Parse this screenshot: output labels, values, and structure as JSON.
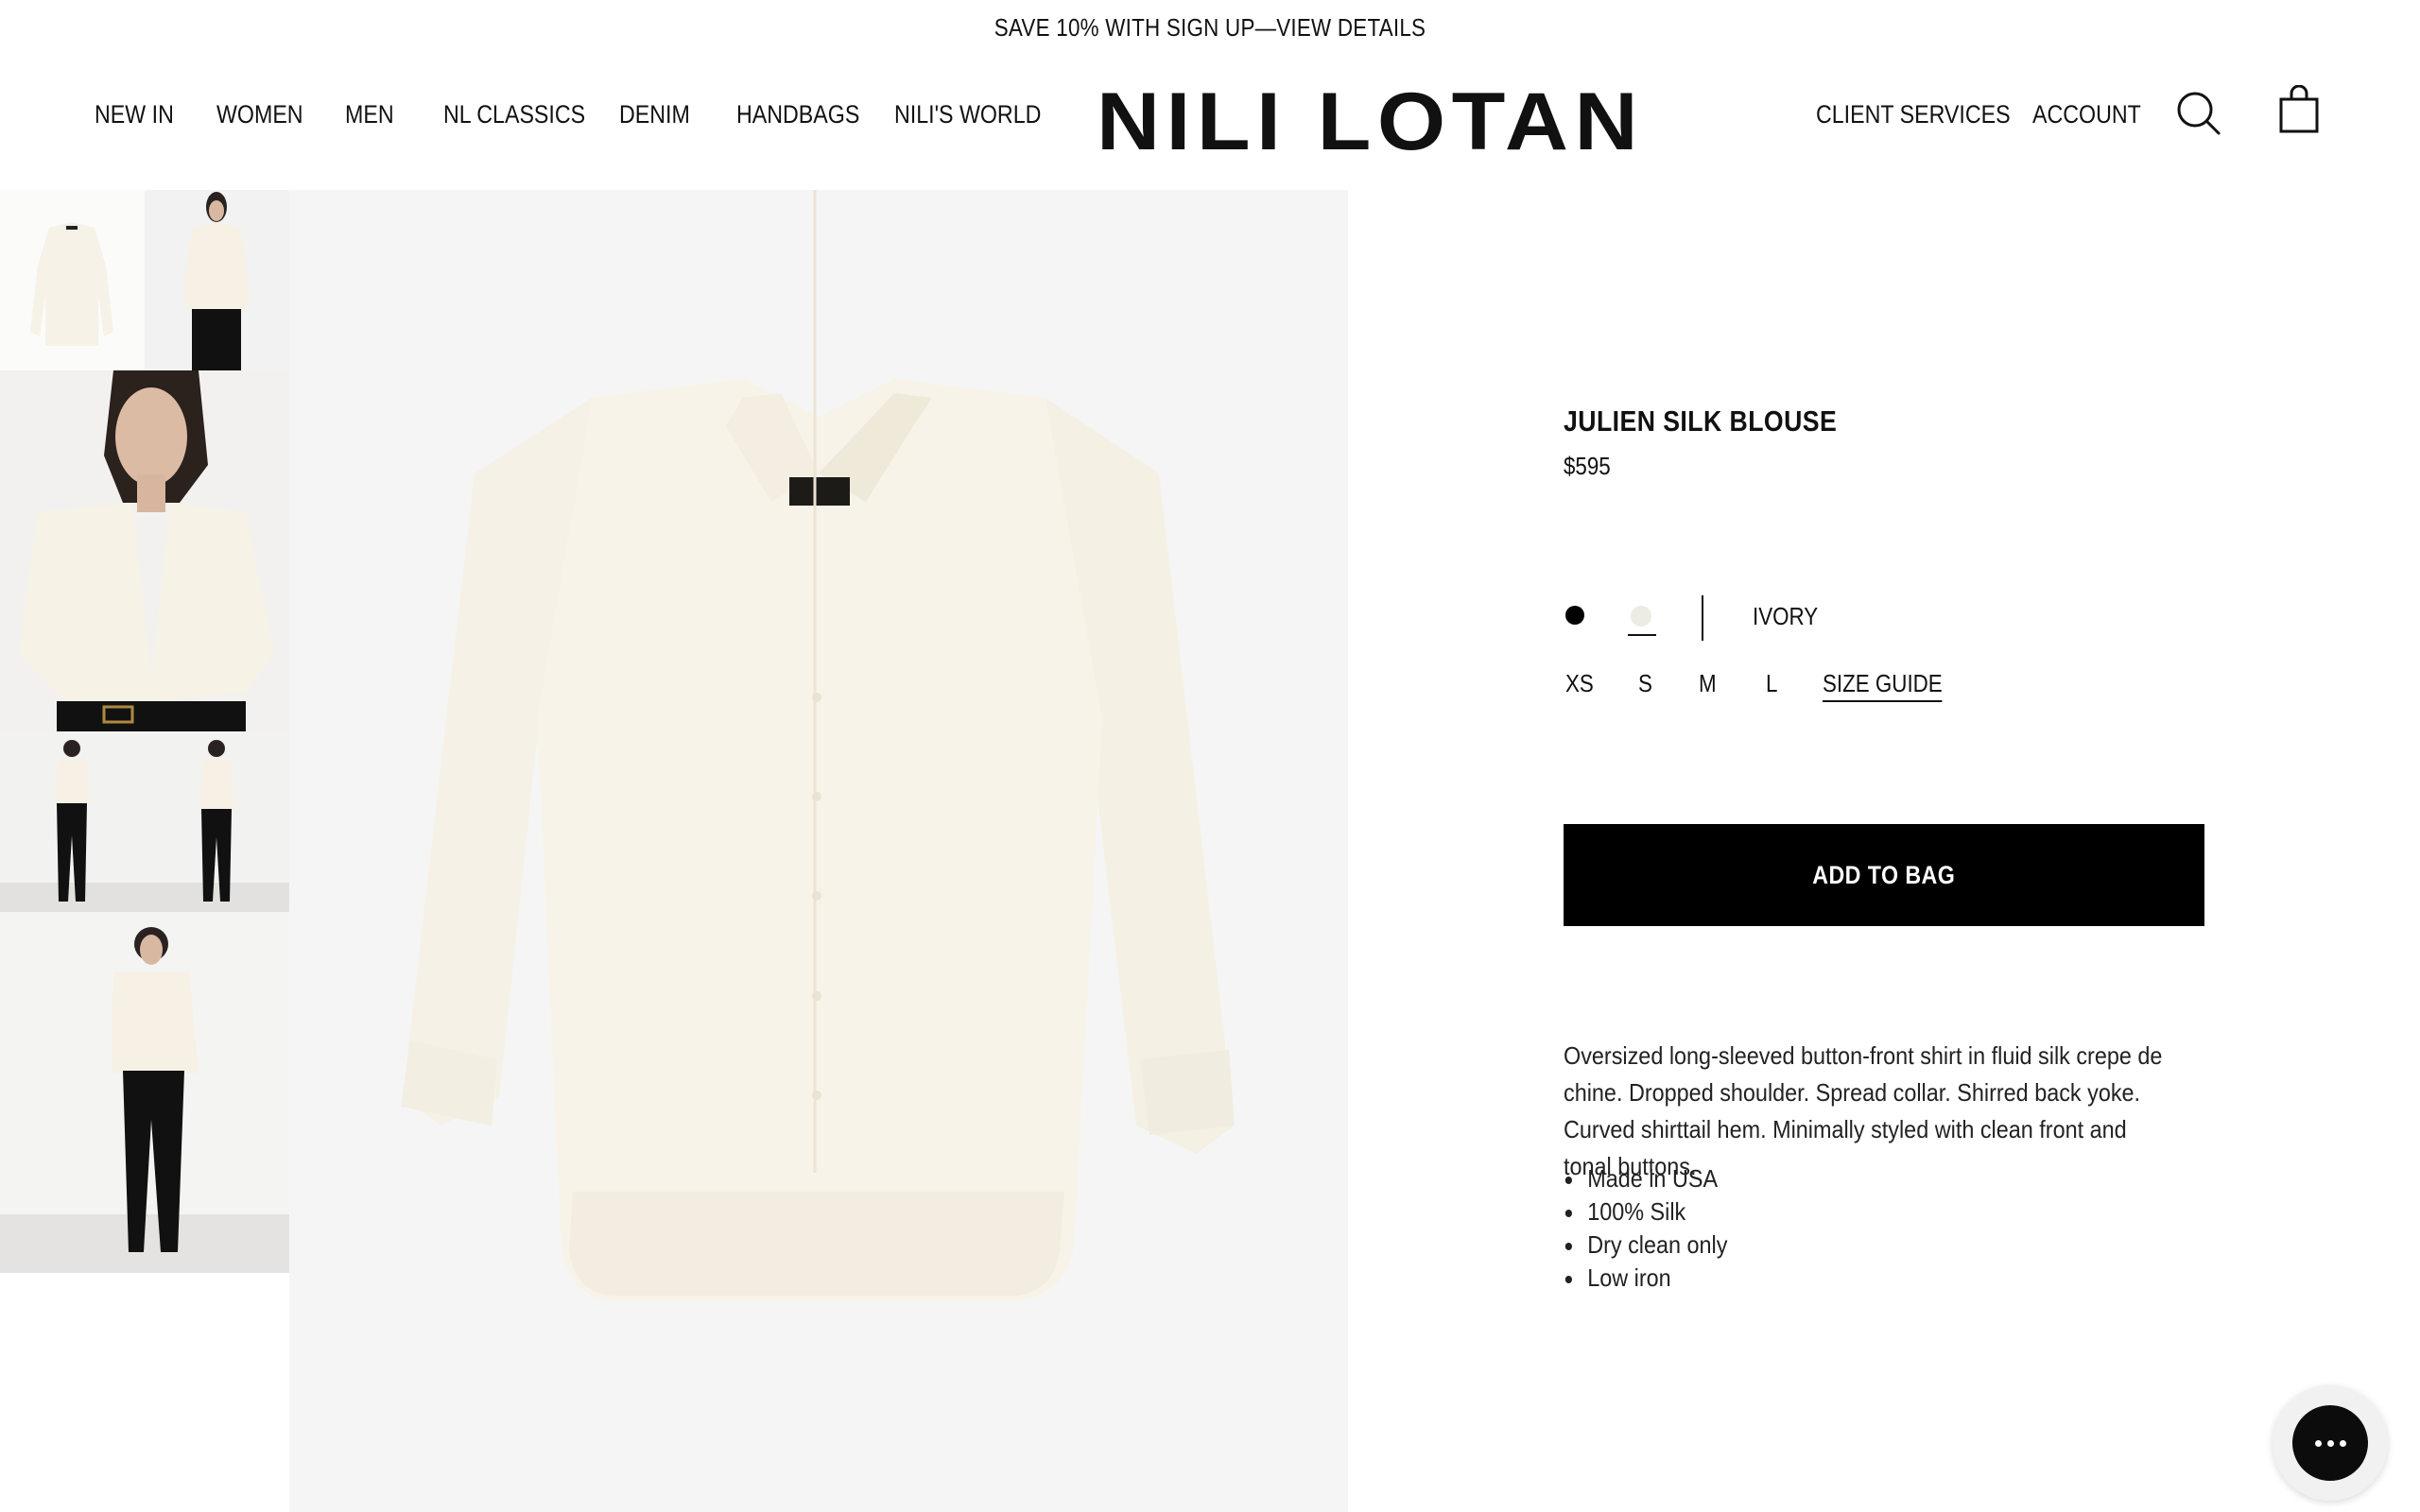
{
  "announcement": {
    "text": "SAVE 10% WITH SIGN UP—VIEW DETAILS"
  },
  "nav": {
    "left": [
      "NEW IN",
      "WOMEN",
      "MEN",
      "NL CLASSICS",
      "DENIM",
      "HANDBAGS",
      "NILI'S WORLD"
    ],
    "right": [
      "CLIENT SERVICES",
      "ACCOUNT"
    ]
  },
  "brand": {
    "logo": "NILI LOTAN"
  },
  "icons": {
    "search": "search-icon",
    "bag": "shopping-bag-icon",
    "chat": "chat-icon"
  },
  "product": {
    "title": "JULIEN SILK BLOUSE",
    "price": "$595",
    "selected_color": "IVORY",
    "colors": [
      {
        "name": "black",
        "hex": "#000000"
      },
      {
        "name": "ivory",
        "hex": "#ecebe4"
      }
    ],
    "sizes": [
      "XS",
      "S",
      "M",
      "L"
    ],
    "size_guide": "SIZE GUIDE",
    "add_to_bag": "ADD TO BAG",
    "description": "Oversized long-sleeved button-front shirt in fluid silk crepe de chine. Dropped shoulder. Spread collar. Shirred back yoke. Curved shirttail hem. Minimally styled with clean front and tonal buttons.",
    "details": [
      "Made in USA",
      "100% Silk",
      "Dry clean only",
      "Low iron"
    ]
  },
  "colors": {
    "background": "#ffffff",
    "image_bg": "#f5f5f5",
    "shirt": "#f7f3e8",
    "button": "#000000",
    "text": "#111111"
  }
}
